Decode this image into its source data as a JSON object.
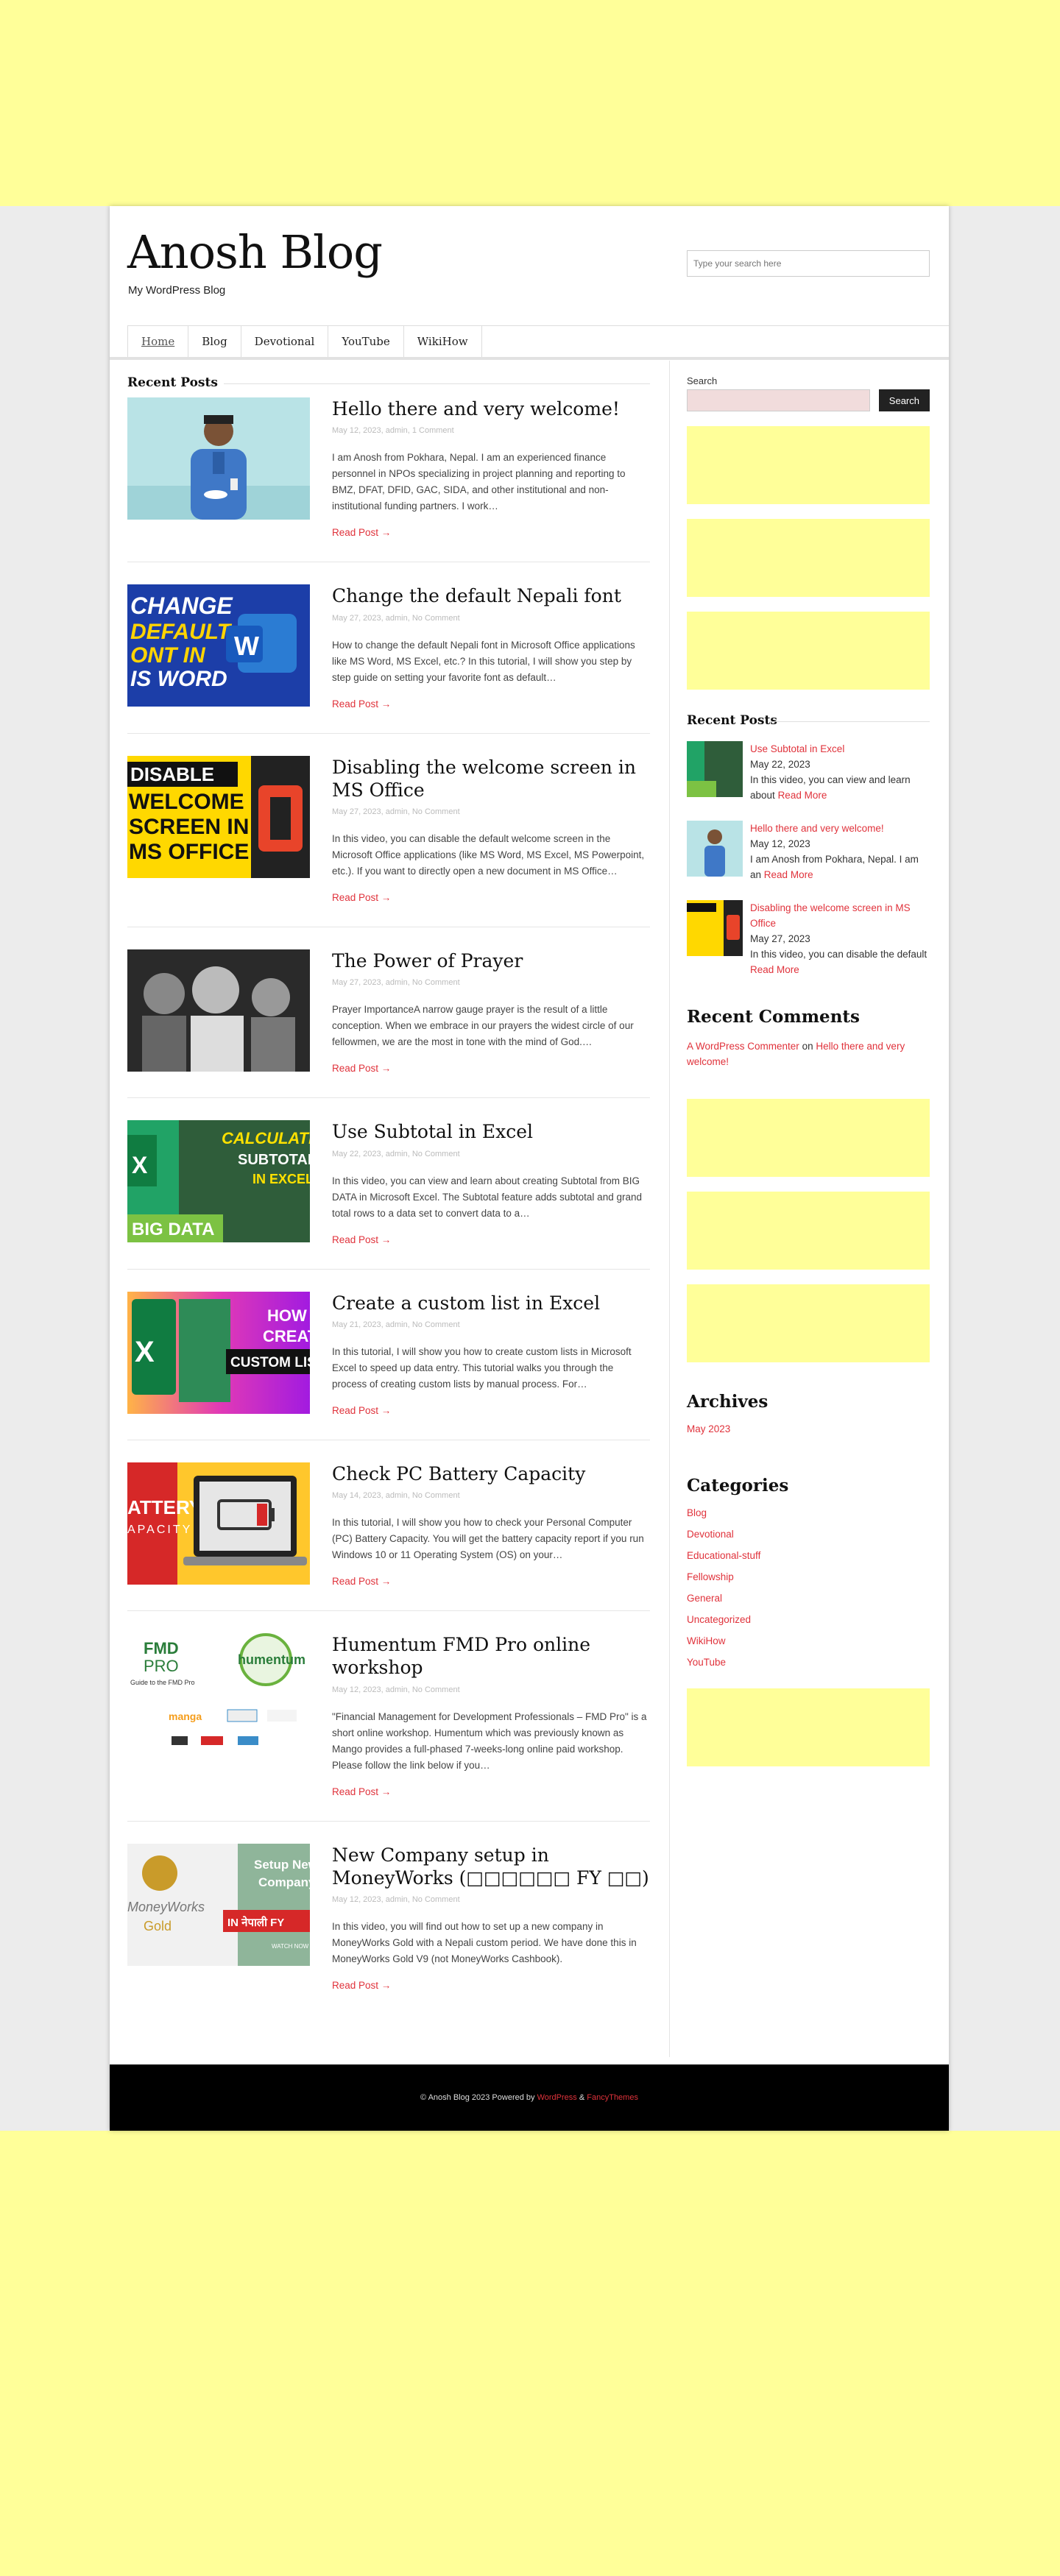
{
  "header": {
    "site_title": "Anosh Blog",
    "site_description": "My WordPress Blog",
    "search_placeholder": "Type your search here"
  },
  "nav": [
    {
      "label": "Home"
    },
    {
      "label": "Blog"
    },
    {
      "label": "Devotional"
    },
    {
      "label": "YouTube"
    },
    {
      "label": "WikiHow"
    }
  ],
  "main": {
    "section_title": "Recent Posts",
    "posts": [
      {
        "title": "Hello there and very welcome!",
        "meta": "May 12, 2023, admin, 1 Comment",
        "excerpt": "I am Anosh from Pokhara, Nepal. I am an experienced finance personnel in NPOs specializing in project planning and reporting to BMZ, DFAT, DFID, GAC, SIDA, and other institutional and non-institutional funding partners. I work…",
        "read_more": "Read Post →"
      },
      {
        "title": "Change the default Nepali font",
        "meta": "May 27, 2023, admin, No Comment",
        "excerpt": "How to change the default Nepali font in Microsoft Office applications like MS Word, MS Excel, etc.? In this tutorial, I will show you step by step guide on setting your favorite font as default…",
        "read_more": "Read Post →"
      },
      {
        "title": "Disabling the welcome screen in MS Office",
        "meta": "May 27, 2023, admin, No Comment",
        "excerpt": "In this video, you can disable the default welcome screen in the Microsoft Office applications (like MS Word, MS Excel, MS Powerpoint, etc.). If you want to directly open a new document in MS Office…",
        "read_more": "Read Post →"
      },
      {
        "title": "The Power of Prayer",
        "meta": "May 27, 2023, admin, No Comment",
        "excerpt": "Prayer ImportanceA narrow gauge prayer is the result of a little conception. When we embrace in our prayers the widest circle of our fellowmen, we are the most in tone with the mind of God.…",
        "read_more": "Read Post →"
      },
      {
        "title": "Use Subtotal in Excel",
        "meta": "May 22, 2023, admin, No Comment",
        "excerpt": "In this video, you can view and learn about creating Subtotal from BIG DATA in Microsoft Excel. The Subtotal feature adds subtotal and grand total rows to a data set to convert data to a…",
        "read_more": "Read Post →"
      },
      {
        "title": "Create a custom list in Excel",
        "meta": "May 21, 2023, admin, No Comment",
        "excerpt": "In this tutorial, I will show you how to create custom lists in Microsoft Excel to speed up data entry. This tutorial walks you through the process of creating custom lists by manual process. For…",
        "read_more": "Read Post →"
      },
      {
        "title": "Check PC Battery Capacity",
        "meta": "May 14, 2023, admin, No Comment",
        "excerpt": "In this tutorial, I will show you how to check your Personal Computer (PC) Battery Capacity. You will get the battery capacity report if you run Windows 10 or 11 Operating System (OS) on your…",
        "read_more": "Read Post →"
      },
      {
        "title": "Humentum FMD Pro online workshop",
        "meta": "May 12, 2023, admin, No Comment",
        "excerpt": "\"Financial Management for Development Professionals – FMD Pro\" is a short online workshop. Humentum which was previously known as Mango provides a full-phased 7-weeks-long online paid workshop. Please follow the link below if you…",
        "read_more": "Read Post →"
      },
      {
        "title": "New Company setup in MoneyWorks (□□□□□□ FY □□)",
        "meta": "May 12, 2023, admin, No Comment",
        "excerpt": "In this video, you will find out how to set up a new company in MoneyWorks Gold with a Nepali custom period. We have done this in MoneyWorks Gold V9 (not MoneyWorks Cashbook).",
        "read_more": "Read Post →"
      }
    ],
    "thumb_texts": {
      "t2": [
        "CHANGE",
        "DEFAULT",
        "ONT IN",
        "IS WORD",
        "W"
      ],
      "t3": [
        "DISABLE",
        "WELCOME",
        "SCREEN IN",
        "MS OFFICE"
      ],
      "t5": [
        "CALCULATE",
        "SUBTOTAL",
        "IN EXCEL",
        "BIG DATA",
        "X"
      ],
      "t6": [
        "HOW TO",
        "CREATE",
        "CUSTOM LIST",
        "X"
      ],
      "t7": [
        "ATTERY",
        "APACITY"
      ],
      "t8": [
        "FMD",
        "PRO",
        "Guide to the FMD Pro",
        "humentum",
        "manga"
      ],
      "t9": [
        "MoneyWorks",
        "Gold",
        "Setup New",
        "Company",
        "IN नेपाली FY",
        "WATCH NOW"
      ]
    }
  },
  "sidebar": {
    "search_label": "Search",
    "search_button": "Search",
    "recent_posts_title": "Recent Posts",
    "recent_posts": [
      {
        "title": "Use Subtotal in Excel",
        "date": "May 22, 2023",
        "excerpt": "In this video, you can view and learn about",
        "read_more": "Read More"
      },
      {
        "title": "Hello there and very welcome!",
        "date": "May 12, 2023",
        "excerpt": "I am Anosh from Pokhara, Nepal. I am an",
        "read_more": "Read More"
      },
      {
        "title": "Disabling the welcome screen in MS Office",
        "date": "May 27, 2023",
        "excerpt": "In this video, you can disable the default",
        "read_more": "Read More"
      }
    ],
    "recent_comments_title": "Recent Comments",
    "comment": {
      "author": "A WordPress Commenter",
      "on": "on",
      "post": "Hello there and very welcome!"
    },
    "archives_title": "Archives",
    "archives": [
      "May 2023"
    ],
    "categories_title": "Categories",
    "categories": [
      "Blog",
      "Devotional",
      "Educational-stuff",
      "Fellowship",
      "General",
      "Uncategorized",
      "WikiHow",
      "YouTube"
    ]
  },
  "footer": {
    "prefix": "© Anosh Blog 2023 Powered by",
    "link1": "WordPress",
    "amp": "&",
    "link2": "FancyThemes"
  }
}
